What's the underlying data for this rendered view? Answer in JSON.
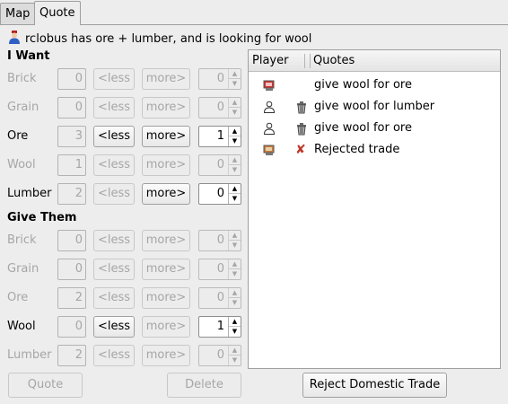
{
  "tabs": [
    {
      "label": "Map"
    },
    {
      "label": "Quote"
    }
  ],
  "status": {
    "text": "rclobus has ore + lumber, and is looking for wool"
  },
  "i_want": {
    "heading": "I Want",
    "rows": [
      {
        "resource": "Brick",
        "available": "0",
        "less": "<less",
        "more": "more>",
        "amount": "0"
      },
      {
        "resource": "Grain",
        "available": "0",
        "less": "<less",
        "more": "more>",
        "amount": "0"
      },
      {
        "resource": "Ore",
        "available": "3",
        "less": "<less",
        "more": "more>",
        "amount": "1"
      },
      {
        "resource": "Wool",
        "available": "1",
        "less": "<less",
        "more": "more>",
        "amount": "0"
      },
      {
        "resource": "Lumber",
        "available": "2",
        "less": "<less",
        "more": "more>",
        "amount": "0"
      }
    ]
  },
  "give_them": {
    "heading": "Give Them",
    "rows": [
      {
        "resource": "Brick",
        "available": "0",
        "less": "<less",
        "more": "more>",
        "amount": "0"
      },
      {
        "resource": "Grain",
        "available": "0",
        "less": "<less",
        "more": "more>",
        "amount": "0"
      },
      {
        "resource": "Ore",
        "available": "2",
        "less": "<less",
        "more": "more>",
        "amount": "0"
      },
      {
        "resource": "Wool",
        "available": "0",
        "less": "<less",
        "more": "more>",
        "amount": "1"
      },
      {
        "resource": "Lumber",
        "available": "2",
        "less": "<less",
        "more": "more>",
        "amount": "0"
      }
    ]
  },
  "quotes": {
    "headers": {
      "player": "Player",
      "quotes": "Quotes"
    },
    "rows": [
      {
        "player_icon": "computer-player-icon",
        "action_icon": "",
        "text": "give wool for ore"
      },
      {
        "player_icon": "human-player-icon",
        "action_icon": "trash-can-icon",
        "text": "give wool for lumber"
      },
      {
        "player_icon": "human-player-icon",
        "action_icon": "trash-can-icon",
        "text": "give wool for ore"
      },
      {
        "player_icon": "computer-player-icon",
        "action_icon": "reject-x-icon",
        "text": "Rejected trade"
      }
    ]
  },
  "buttons": {
    "quote": "Quote",
    "delete": "Delete",
    "reject": "Reject Domestic Trade"
  },
  "icons": {
    "up_arrow": "▲",
    "down_arrow": "▼",
    "reject_mark": "✘"
  }
}
